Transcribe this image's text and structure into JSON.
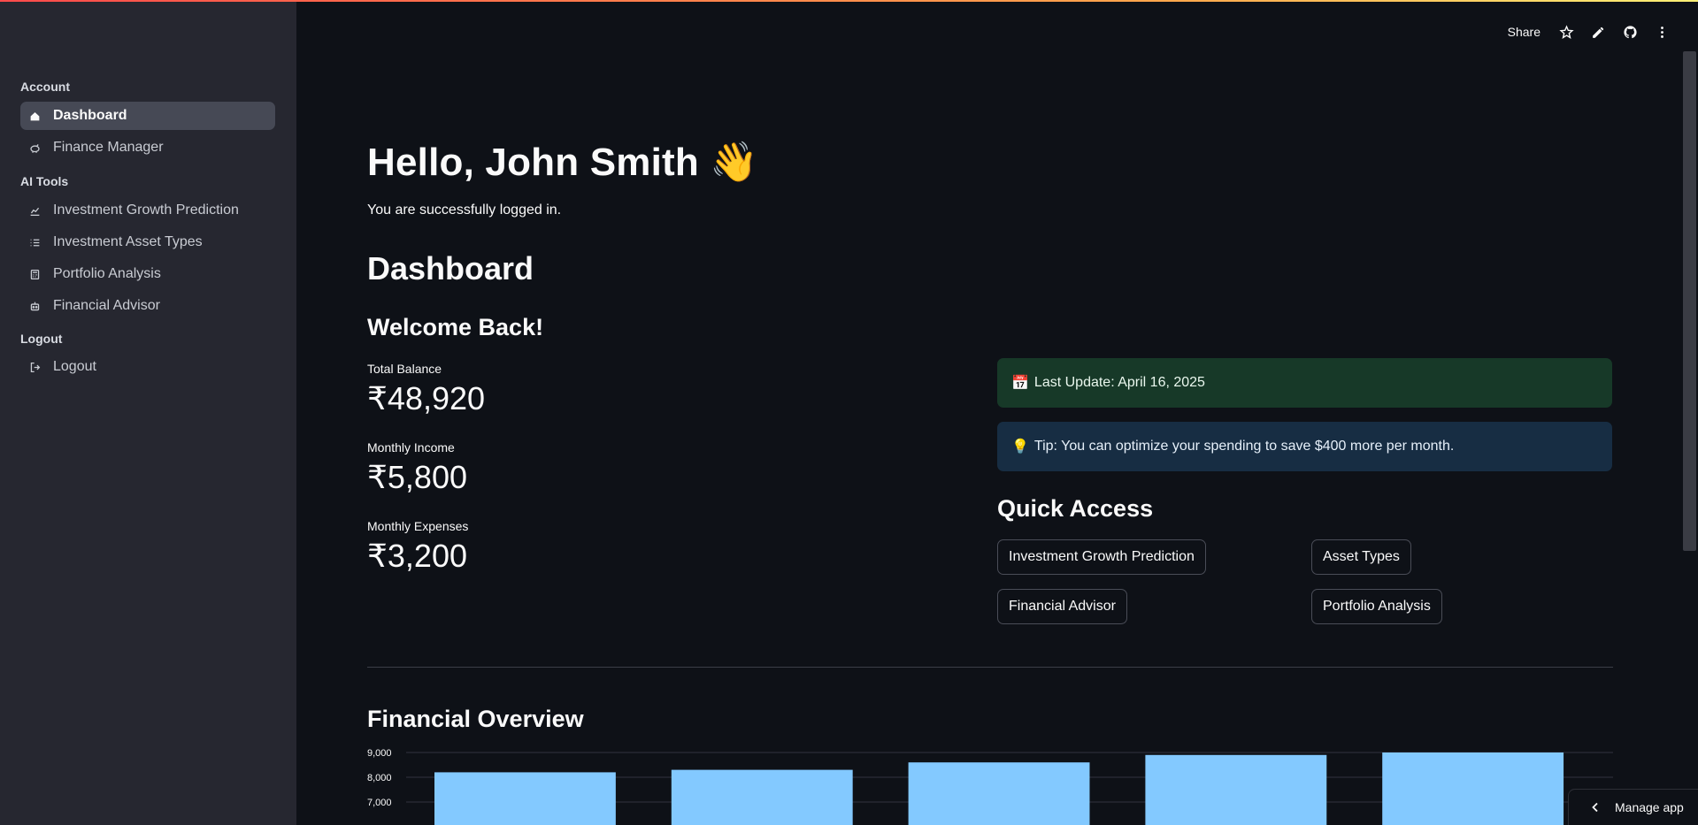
{
  "sidebar": {
    "sections": [
      {
        "title": "Account",
        "items": [
          {
            "label": "Dashboard",
            "icon": "home-icon",
            "active": true
          },
          {
            "label": "Finance Manager",
            "icon": "piggy-bank-icon"
          }
        ]
      },
      {
        "title": "AI Tools",
        "items": [
          {
            "label": "Investment Growth Prediction",
            "icon": "chart-line-icon"
          },
          {
            "label": "Investment Asset Types",
            "icon": "list-icon"
          },
          {
            "label": "Portfolio Analysis",
            "icon": "calculator-icon"
          },
          {
            "label": "Financial Advisor",
            "icon": "robot-icon"
          }
        ]
      },
      {
        "title": "Logout",
        "items": [
          {
            "label": "Logout",
            "icon": "logout-icon"
          }
        ]
      }
    ]
  },
  "header": {
    "share_label": "Share",
    "icons": [
      "star-icon",
      "pencil-icon",
      "github-icon",
      "more-vertical-icon"
    ]
  },
  "main": {
    "greeting": "Hello, John Smith 👋",
    "logged_in_text": "You are successfully logged in.",
    "dashboard_heading": "Dashboard",
    "welcome_heading": "Welcome Back!",
    "metrics": [
      {
        "label": "Total Balance",
        "value": "₹48,920"
      },
      {
        "label": "Monthly Income",
        "value": "₹5,800"
      },
      {
        "label": "Monthly Expenses",
        "value": "₹3,200"
      }
    ],
    "alerts": {
      "last_update": {
        "emoji": "📅",
        "text": "Last Update: April 16, 2025"
      },
      "tip": {
        "emoji": "💡",
        "text": "Tip: You can optimize your spending to save $400 more per month."
      }
    },
    "quick_access_heading": "Quick Access",
    "quick_access_buttons": [
      "Investment Growth Prediction",
      "Asset Types",
      "Financial Advisor",
      "Portfolio Analysis"
    ],
    "overview_heading": "Financial Overview"
  },
  "manage_app_label": "Manage app",
  "colors": {
    "background": "#0e1117",
    "sidebar": "#262730",
    "bar": "#83c9ff",
    "success_bg": "#173928",
    "info_bg": "#172d43"
  },
  "chart_data": {
    "type": "bar",
    "categories": [
      "",
      "",
      "",
      "",
      ""
    ],
    "values": [
      8200,
      8300,
      8600,
      8900,
      9000
    ],
    "title": "",
    "xlabel": "",
    "ylabel": "",
    "ylim": [
      6000,
      9000
    ],
    "yticks": [
      9000,
      8000,
      7000
    ],
    "ytick_labels": [
      "9,000",
      "8,000",
      "7,000"
    ],
    "grid": true,
    "bar_color": "#83c9ff"
  }
}
